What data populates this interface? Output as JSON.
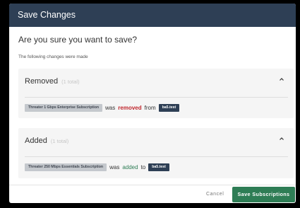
{
  "dialog": {
    "title": "Save Changes",
    "question": "Are you sure you want to save?",
    "subtitle": "The following changes were made"
  },
  "removed": {
    "heading": "Removed",
    "count": "(1 total)",
    "item": "Threater 1 Gbps Enterprise Subscription",
    "verb_prefix": "was",
    "verb": "removed",
    "preposition": "from",
    "target": "ba5.test"
  },
  "added": {
    "heading": "Added",
    "count": "(1 total)",
    "item": "Threater 250 Mbps Essentials Subscription",
    "verb_prefix": "was",
    "verb": "added",
    "preposition": "to",
    "target": "ba5.test"
  },
  "footer": {
    "cancel_label": "Cancel",
    "save_label": "Save Subscriptions"
  },
  "colors": {
    "header": "#2e3f55",
    "accent_green": "#2e7d55",
    "removed_red": "#c0272d"
  },
  "icons": {
    "collapse": "chevron-up-icon"
  }
}
